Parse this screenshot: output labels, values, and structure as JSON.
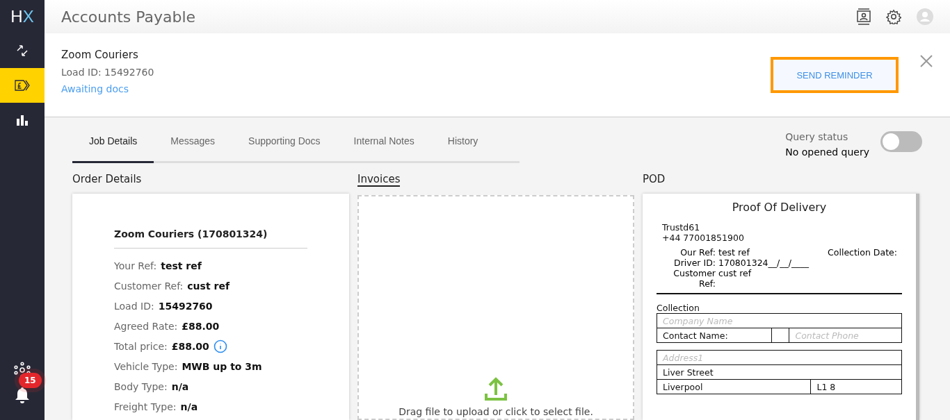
{
  "logo": {
    "first": "H",
    "second": "X"
  },
  "nav": [
    {
      "kind": "transfer",
      "selected": false
    },
    {
      "kind": "pound",
      "selected": true
    },
    {
      "kind": "chart",
      "selected": false
    }
  ],
  "nav_bottom": {
    "notifications": "15"
  },
  "header": {
    "title": "Accounts Payable"
  },
  "summary": {
    "company": "Zoom Couriers",
    "load_id": "Load ID: 15492760",
    "status": "Awaiting docs",
    "button": "SEND REMINDER"
  },
  "tabs": [
    {
      "label": "Job Details",
      "selected": true
    },
    {
      "label": "Messages",
      "selected": false
    },
    {
      "label": "Supporting Docs",
      "selected": false
    },
    {
      "label": "Internal Notes",
      "selected": false
    },
    {
      "label": "History",
      "selected": false
    }
  ],
  "query": {
    "label": "Query status",
    "value": "No opened query",
    "on": false
  },
  "order_details": {
    "heading": "Order Details",
    "title": "Zoom Couriers (170801324)",
    "fields": [
      {
        "label": "Your Ref:",
        "value": "test ref"
      },
      {
        "label": "Customer Ref:",
        "value": "cust ref"
      },
      {
        "label": "Load ID:",
        "value": "15492760"
      },
      {
        "label": "Agreed Rate:",
        "value": "£88.00"
      },
      {
        "label": "Total price:",
        "value": "£88.00",
        "info": true
      },
      {
        "label": "Vehicle Type:",
        "value": "MWB up to 3m"
      },
      {
        "label": "Body Type:",
        "value": "n/a"
      },
      {
        "label": "Freight Type:",
        "value": "n/a"
      }
    ]
  },
  "invoices": {
    "heading": "Invoices",
    "drop_text": "Drag file to upload or click to select file."
  },
  "pod": {
    "heading": "POD",
    "title": "Proof Of Delivery",
    "name": "Trustd61",
    "phone": "+44 77001851900",
    "refs": [
      {
        "label": "Our Ref:",
        "value": "test ref"
      },
      {
        "label": "Driver ID:",
        "value": "170801324"
      },
      {
        "label": "Customer Ref:",
        "value": "cust ref"
      }
    ],
    "collection_date_label": "Collection Date:",
    "collection_date": "__/__/____",
    "section": "Collection",
    "table1": [
      {
        "kind": "full",
        "cells": [
          {
            "text": "Company Name",
            "kind": "placeholder"
          }
        ]
      },
      {
        "kind": "triple",
        "cells": [
          {
            "text": "Contact Name:",
            "kind": "value"
          },
          {
            "kind": "value"
          },
          {
            "text": "Contact Phone",
            "kind": "placeholder"
          }
        ]
      }
    ],
    "table2": [
      {
        "kind": "full",
        "cells": [
          {
            "text": "Address1",
            "kind": "placeholder"
          }
        ]
      },
      {
        "kind": "full",
        "cells": [
          {
            "text": "Liver Street",
            "kind": "value"
          }
        ]
      },
      {
        "kind": "pair",
        "cells": [
          {
            "text": "Liverpool",
            "kind": "value"
          },
          {
            "text": "L1 8",
            "kind": "value"
          }
        ]
      }
    ]
  }
}
